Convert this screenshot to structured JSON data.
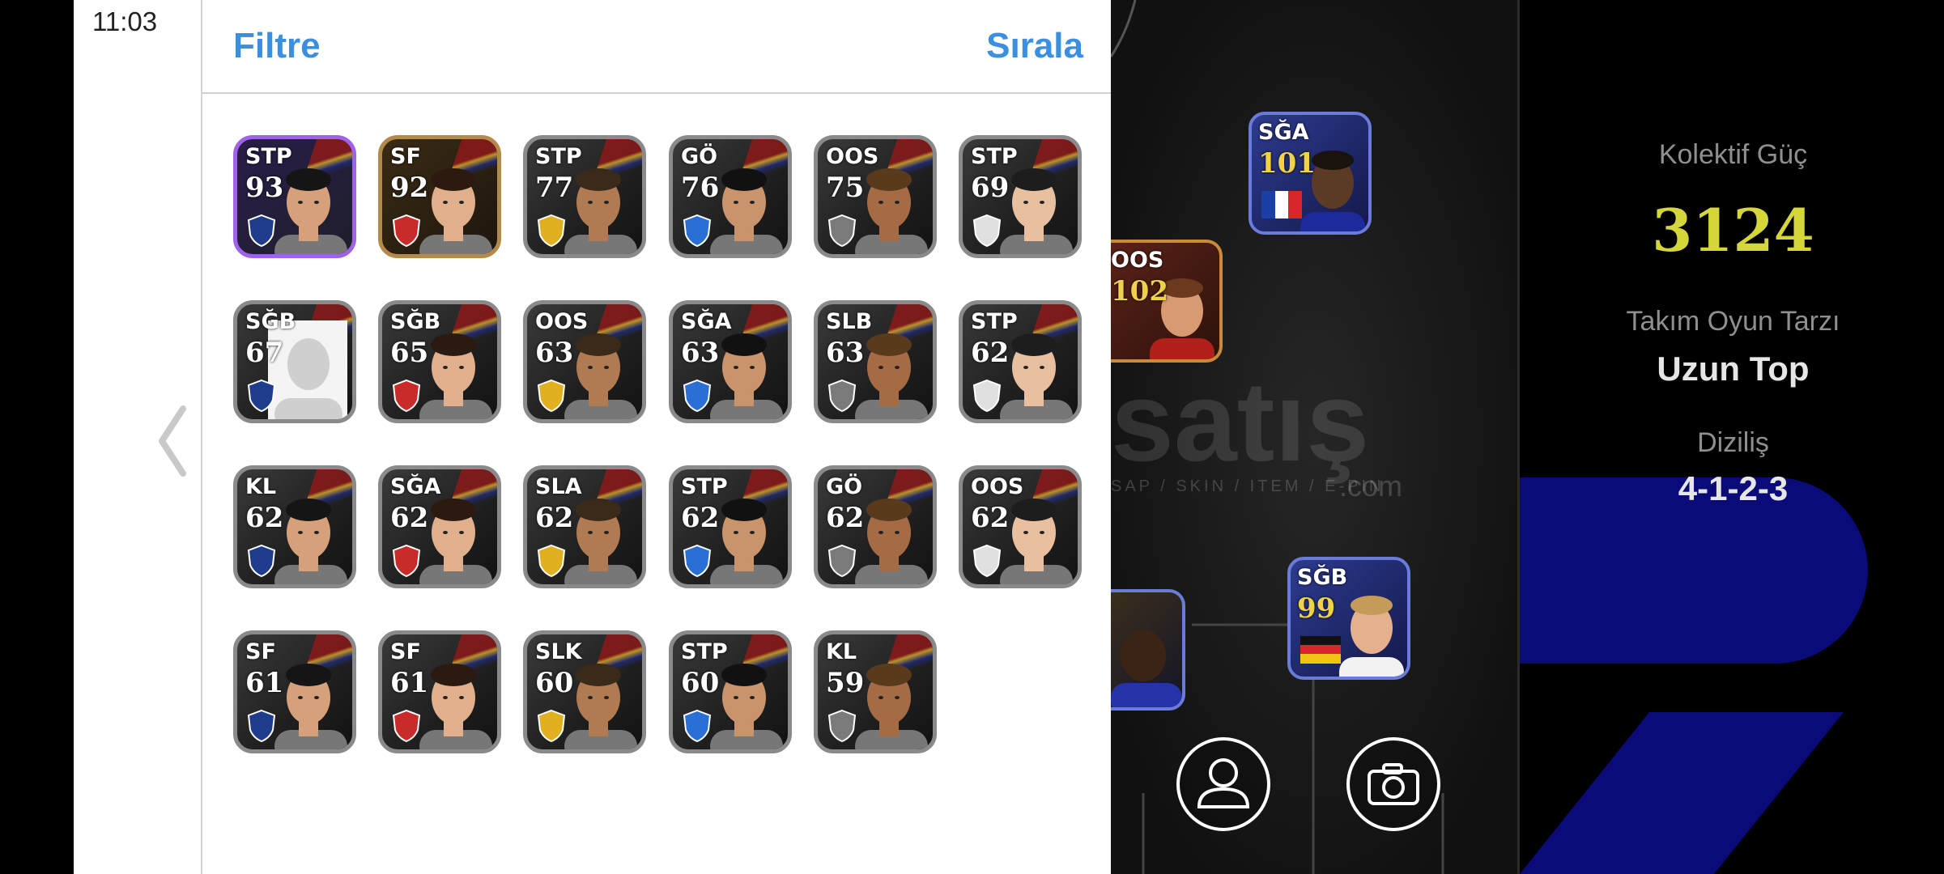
{
  "status_bar": {
    "time": "11:03"
  },
  "panel": {
    "filter_label": "Filtre",
    "sort_label": "Sırala"
  },
  "players": [
    {
      "position": "STP",
      "rating": "93",
      "style": "purple"
    },
    {
      "position": "SF",
      "rating": "92",
      "style": "gold"
    },
    {
      "position": "STP",
      "rating": "77",
      "style": "dark"
    },
    {
      "position": "GÖ",
      "rating": "76",
      "style": "dark"
    },
    {
      "position": "OOS",
      "rating": "75",
      "style": "dark"
    },
    {
      "position": "STP",
      "rating": "69",
      "style": "dark"
    },
    {
      "position": "SĞB",
      "rating": "67",
      "style": "placeholder"
    },
    {
      "position": "SĞB",
      "rating": "65",
      "style": "dark"
    },
    {
      "position": "OOS",
      "rating": "63",
      "style": "dark"
    },
    {
      "position": "SĞA",
      "rating": "63",
      "style": "dark"
    },
    {
      "position": "SLB",
      "rating": "63",
      "style": "dark"
    },
    {
      "position": "STP",
      "rating": "62",
      "style": "dark"
    },
    {
      "position": "KL",
      "rating": "62",
      "style": "dark"
    },
    {
      "position": "SĞA",
      "rating": "62",
      "style": "dark"
    },
    {
      "position": "SLA",
      "rating": "62",
      "style": "dark"
    },
    {
      "position": "STP",
      "rating": "62",
      "style": "dark"
    },
    {
      "position": "GÖ",
      "rating": "62",
      "style": "dark"
    },
    {
      "position": "OOS",
      "rating": "62",
      "style": "dark"
    },
    {
      "position": "SF",
      "rating": "61",
      "style": "dark"
    },
    {
      "position": "SF",
      "rating": "61",
      "style": "dark"
    },
    {
      "position": "SLK",
      "rating": "60",
      "style": "dark"
    },
    {
      "position": "STP",
      "rating": "60",
      "style": "dark"
    },
    {
      "position": "KL",
      "rating": "59",
      "style": "dark"
    }
  ],
  "pitch": {
    "watermark": {
      "word": "satış",
      "tagline": "SAP / SKIN / ITEM / E-PIN",
      "suffix": ".com"
    },
    "cards": [
      {
        "position": "SĞA",
        "rating": "101",
        "flag": "france"
      },
      {
        "position": "OOS",
        "rating": "102",
        "flag": ""
      },
      {
        "position": "SĞB",
        "rating": "99",
        "flag": "germany"
      }
    ]
  },
  "stats": {
    "collective_power_label": "Kolektif Güç",
    "collective_power_value": "3124",
    "playstyle_label": "Takım Oyun Tarzı",
    "playstyle_value": "Uzun Top",
    "formation_label": "Diziliş",
    "formation_value": "4-1-2-3"
  },
  "icons": {
    "back": "chevron-left-icon",
    "profile": "user-icon",
    "camera": "camera-icon"
  },
  "colors": {
    "accent": "#3a8fe0",
    "power": "#d4d63a",
    "stats_shape": "#0a0a78"
  }
}
